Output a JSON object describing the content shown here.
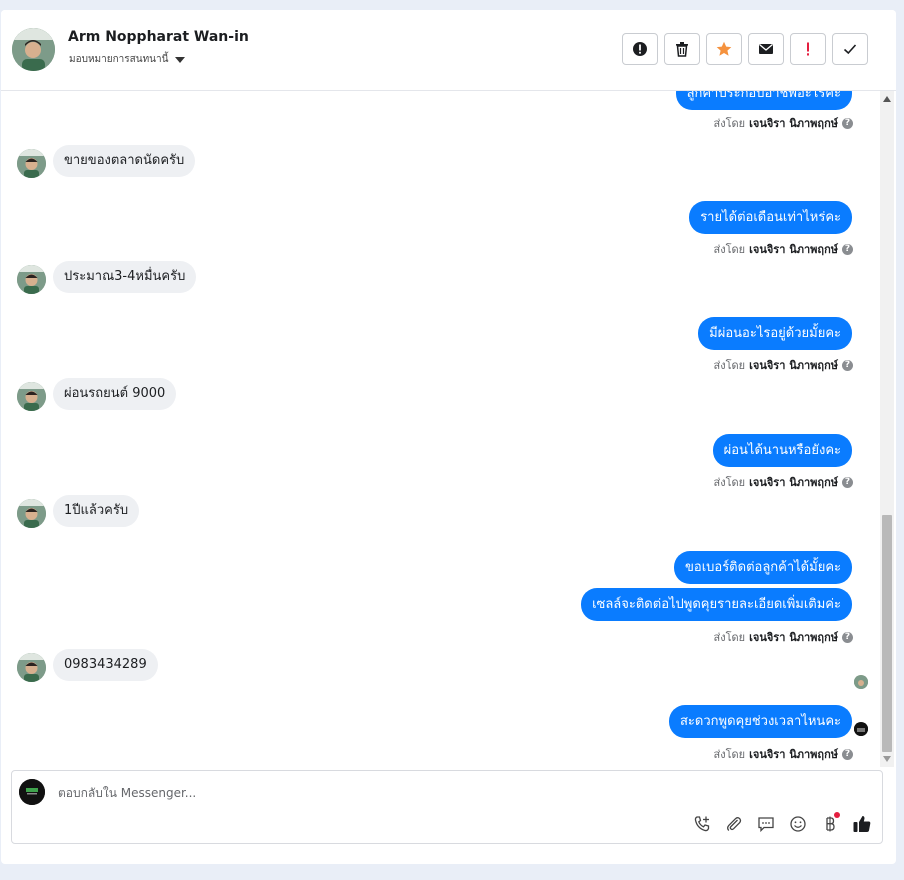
{
  "header": {
    "name": "Arm Noppharat Wan-in",
    "assign_label": "มอบหมายการสนทนานี้",
    "actions": [
      {
        "name": "spam",
        "icon": "alert-circle-icon"
      },
      {
        "name": "delete",
        "icon": "trash-icon"
      },
      {
        "name": "star",
        "icon": "star-icon"
      },
      {
        "name": "mark-unread",
        "icon": "envelope-icon"
      },
      {
        "name": "important",
        "icon": "exclamation-icon"
      },
      {
        "name": "done",
        "icon": "checkmark-icon"
      }
    ]
  },
  "colors": {
    "outgoing_bubble": "#0a7cff",
    "incoming_bubble": "#eef0f3",
    "star": "#f5923e",
    "important": "#e41e3f"
  },
  "thread": {
    "top_partial_message": "ลูกค้าประกอบอาชีพอะไรคะ",
    "messages": [
      {
        "dir": "in",
        "text": "ขายของตลาดนัดครับ"
      },
      {
        "dir": "out",
        "text": "รายได้ต่อเดือนเท่าไหร่คะ"
      },
      {
        "dir": "in",
        "text": "ประมาณ3-4หมื่นครับ"
      },
      {
        "dir": "out",
        "text": "มีผ่อนอะไรอยู่ด้วยมั้ยคะ"
      },
      {
        "dir": "in",
        "text": "ผ่อนรถยนต์ 9000"
      },
      {
        "dir": "out",
        "text": "ผ่อนได้นานหรือยังคะ"
      },
      {
        "dir": "in",
        "text": "1ปีแล้วครับ"
      },
      {
        "dir": "out",
        "text": "ขอเบอร์ติดต่อลูกค้าได้มั้ยคะ"
      },
      {
        "dir": "out",
        "text": "เซลล์จะติดต่อไปพูดคุยรายละเอียดเพิ่มเติมค่ะ"
      },
      {
        "dir": "in",
        "text": "0983434289"
      },
      {
        "dir": "out",
        "text": "สะดวกพูดคุยช่วงเวลาไหนคะ"
      }
    ],
    "sent_by_prefix": "ส่งโดย",
    "sent_by_name": "เจนจิรา นิภาพฤกษ์",
    "help_glyph": "?"
  },
  "composer": {
    "placeholder": "ตอบกลับใน Messenger...",
    "value": "",
    "icons": [
      "call-plus-icon",
      "paperclip-icon",
      "saved-reply-icon",
      "emoji-icon",
      "baht-icon",
      "thumbs-up-icon"
    ]
  }
}
